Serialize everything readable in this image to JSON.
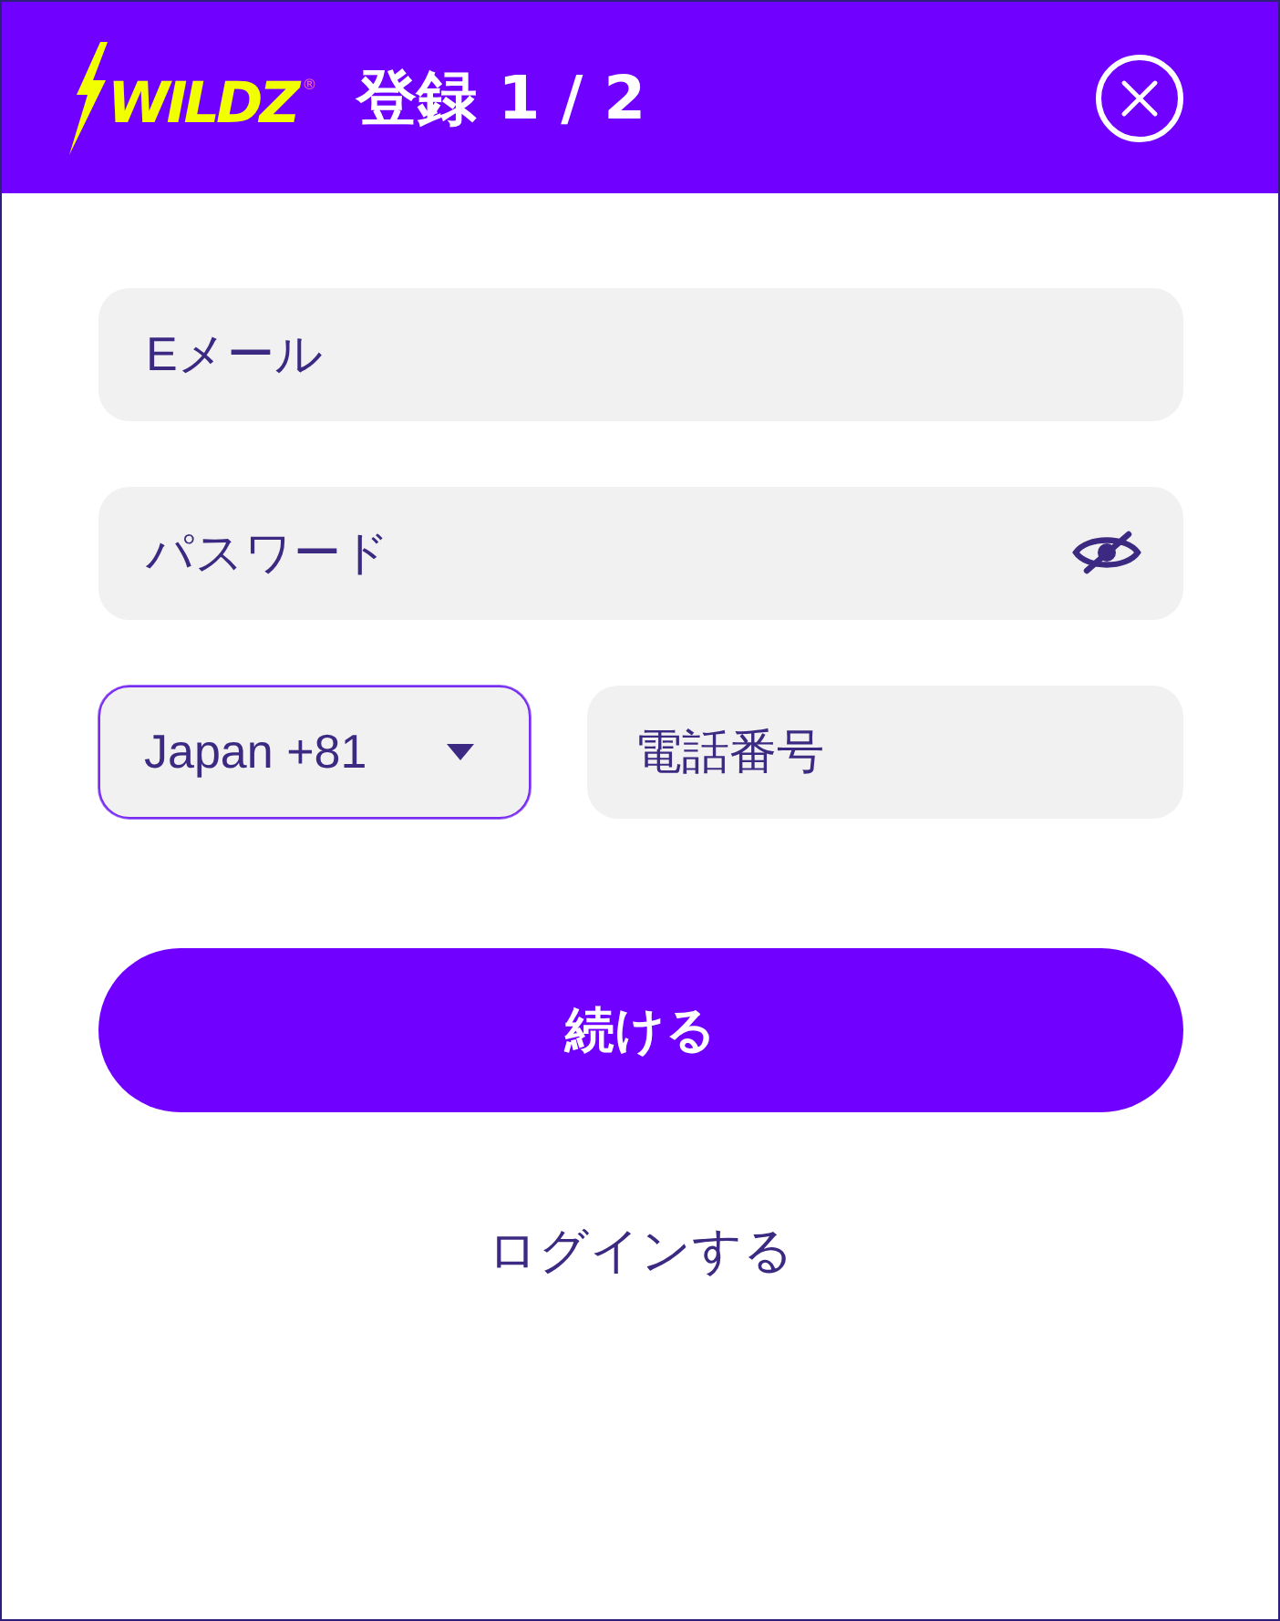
{
  "header": {
    "logo": {
      "text": "WILDZ",
      "mark": "®"
    },
    "title": "登録 1 / 2"
  },
  "fields": [
    {
      "kind": "email",
      "placeholder": "Eメール"
    },
    {
      "kind": "password",
      "placeholder": "パスワード"
    }
  ],
  "phone": {
    "country_select": {
      "value": "Japan +81",
      "focused": true
    },
    "number": {
      "placeholder": "電話番号"
    }
  },
  "continue_button": "続ける",
  "login_link": "ログインする"
}
